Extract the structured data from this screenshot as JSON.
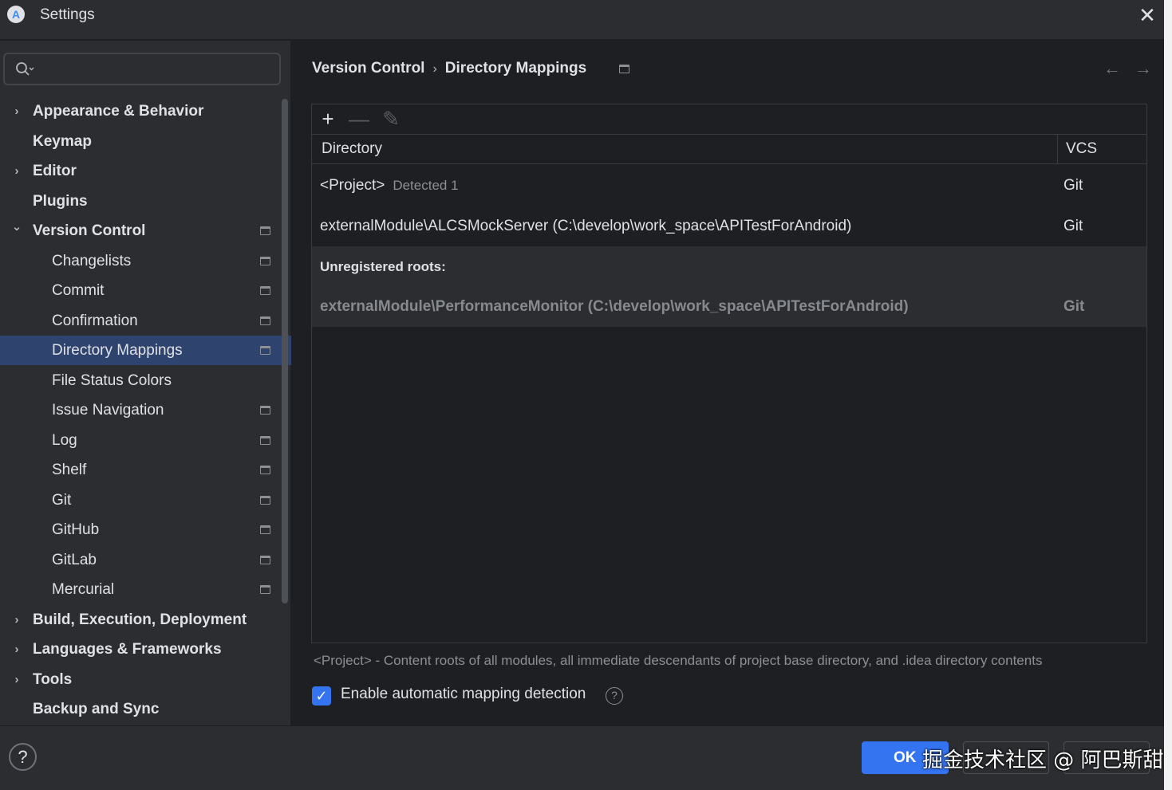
{
  "window": {
    "title": "Settings",
    "logo_glyph": "A"
  },
  "search": {
    "value": "",
    "placeholder": ""
  },
  "sidebar": {
    "items": [
      {
        "label": "Appearance & Behavior",
        "level": 0,
        "expandable": true,
        "expanded": false,
        "project_icon": false
      },
      {
        "label": "Keymap",
        "level": 0,
        "expandable": false,
        "project_icon": false
      },
      {
        "label": "Editor",
        "level": 0,
        "expandable": true,
        "expanded": false,
        "project_icon": false
      },
      {
        "label": "Plugins",
        "level": 0,
        "expandable": false,
        "project_icon": false
      },
      {
        "label": "Version Control",
        "level": 0,
        "expandable": true,
        "expanded": true,
        "project_icon": true
      },
      {
        "label": "Changelists",
        "level": 1,
        "project_icon": true
      },
      {
        "label": "Commit",
        "level": 1,
        "project_icon": true
      },
      {
        "label": "Confirmation",
        "level": 1,
        "project_icon": true
      },
      {
        "label": "Directory Mappings",
        "level": 1,
        "project_icon": true,
        "selected": true
      },
      {
        "label": "File Status Colors",
        "level": 1,
        "project_icon": false
      },
      {
        "label": "Issue Navigation",
        "level": 1,
        "project_icon": true
      },
      {
        "label": "Log",
        "level": 1,
        "project_icon": true
      },
      {
        "label": "Shelf",
        "level": 1,
        "project_icon": true
      },
      {
        "label": "Git",
        "level": 1,
        "project_icon": true
      },
      {
        "label": "GitHub",
        "level": 1,
        "project_icon": true
      },
      {
        "label": "GitLab",
        "level": 1,
        "project_icon": true
      },
      {
        "label": "Mercurial",
        "level": 1,
        "project_icon": true
      },
      {
        "label": "Build, Execution, Deployment",
        "level": 0,
        "expandable": true,
        "expanded": false,
        "project_icon": false
      },
      {
        "label": "Languages & Frameworks",
        "level": 0,
        "expandable": true,
        "expanded": false,
        "project_icon": false
      },
      {
        "label": "Tools",
        "level": 0,
        "expandable": true,
        "expanded": false,
        "project_icon": false
      },
      {
        "label": "Backup and Sync",
        "level": 0,
        "expandable": false,
        "project_icon": false
      }
    ]
  },
  "breadcrumb": {
    "parent": "Version Control",
    "separator": "›",
    "current": "Directory Mappings"
  },
  "nav": {
    "back": "←",
    "forward": "→"
  },
  "toolbar": {
    "add": "+",
    "remove": "—",
    "edit": "✎"
  },
  "table": {
    "columns": {
      "directory": "Directory",
      "vcs": "VCS"
    },
    "rows": [
      {
        "directory": "<Project>",
        "note": "Detected 1",
        "vcs": "Git"
      },
      {
        "directory": "externalModule\\ALCSMockServer (C:\\develop\\work_space\\APITestForAndroid)",
        "note": "",
        "vcs": "Git"
      }
    ],
    "unregistered": {
      "title": "Unregistered roots:",
      "rows": [
        {
          "directory": "externalModule\\PerformanceMonitor (C:\\develop\\work_space\\APITestForAndroid)",
          "vcs": "Git"
        }
      ]
    }
  },
  "hint": "<Project> - Content roots of all modules, all immediate descendants of project base directory, and .idea directory contents",
  "auto_detect": {
    "checked": true,
    "label": "Enable automatic mapping detection",
    "help": "?"
  },
  "footer": {
    "help": "?",
    "ok": "OK",
    "watermark": "掘金技术社区 @ 阿巴斯甜"
  },
  "colors": {
    "accent": "#3574f0",
    "selection": "#2e436e",
    "panel": "#2b2d30",
    "background": "#1e1f22"
  }
}
